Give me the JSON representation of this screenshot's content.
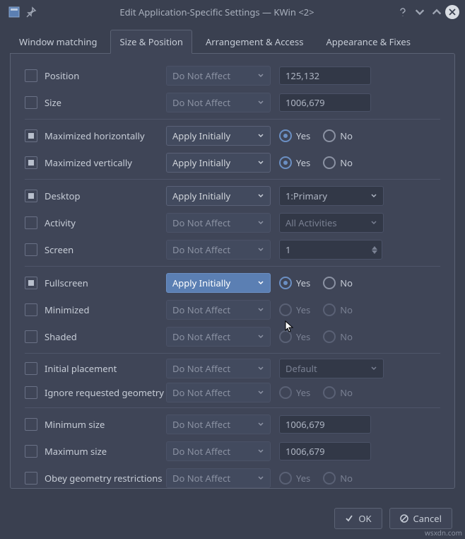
{
  "title": "Edit Application-Specific Settings — KWin <2>",
  "tabs": [
    "Window matching",
    "Size & Position",
    "Arrangement & Access",
    "Appearance & Fixes"
  ],
  "rules": {
    "dna": "Do Not Affect",
    "ai": "Apply Initially"
  },
  "yn": {
    "yes": "Yes",
    "no": "No"
  },
  "rows": {
    "position": {
      "label": "Position",
      "value": "125,132"
    },
    "size": {
      "label": "Size",
      "value": "1006,679"
    },
    "maxh": {
      "label": "Maximized horizontally"
    },
    "maxv": {
      "label": "Maximized vertically"
    },
    "desktop": {
      "label": "Desktop",
      "value": "1:Primary"
    },
    "activity": {
      "label": "Activity",
      "value": "All Activities"
    },
    "screen": {
      "label": "Screen",
      "value": "1"
    },
    "fullscreen": {
      "label": "Fullscreen"
    },
    "minimized": {
      "label": "Minimized"
    },
    "shaded": {
      "label": "Shaded"
    },
    "placement": {
      "label": "Initial placement",
      "value": "Default"
    },
    "ignore": {
      "label": "Ignore requested geometry"
    },
    "min": {
      "label": "Minimum size",
      "value": "1006,679"
    },
    "max": {
      "label": "Maximum size",
      "value": "1006,679"
    },
    "obey": {
      "label": "Obey geometry restrictions"
    }
  },
  "buttons": {
    "ok": "OK",
    "cancel": "Cancel"
  },
  "watermark": "wsxdn.com"
}
